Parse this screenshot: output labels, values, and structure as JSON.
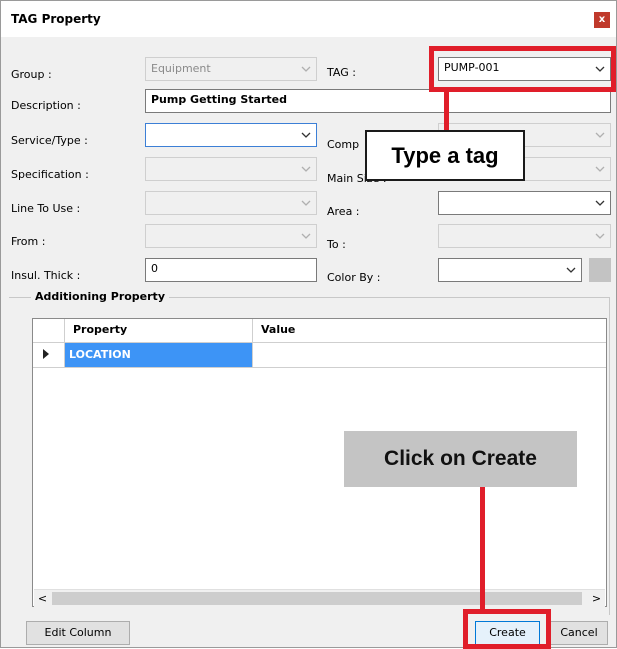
{
  "window": {
    "title": "TAG Property",
    "close_glyph": "x"
  },
  "form": {
    "group_label": "Group :",
    "group_value": "Equipment",
    "tag_label": "TAG :",
    "tag_value": "PUMP-001",
    "description_label": "Description :",
    "description_value": "Pump Getting Started",
    "service_label": "Service/Type :",
    "service_value": "",
    "comp_label": "Comp",
    "spec_label": "Specification :",
    "main_size_label": "Main Size :",
    "line_label": "Line To Use :",
    "area_label": "Area :",
    "from_label": "From :",
    "to_label": "To :",
    "insul_label": "Insul. Thick :",
    "insul_value": "0",
    "color_by_label": "Color By :"
  },
  "additional": {
    "legend": "Additioning Property",
    "columns": [
      "Property",
      "Value"
    ],
    "rows": [
      {
        "property": "LOCATION",
        "value": ""
      }
    ],
    "row_selected_color": "#3d94f6"
  },
  "scroll": {
    "left_glyph": "<",
    "right_glyph": ">"
  },
  "buttons": {
    "edit_column": "Edit Column",
    "create": "Create",
    "cancel": "Cancel"
  },
  "annotations": {
    "type_tag": "Type a tag",
    "click_create": "Click on Create",
    "highlight_color": "#e01e2a"
  },
  "colors": {
    "dialog_bg": "#f0f0f0",
    "title_bar": "#ffffff",
    "close_button": "#c0392b",
    "callout_grey": "#c4c4c4"
  }
}
